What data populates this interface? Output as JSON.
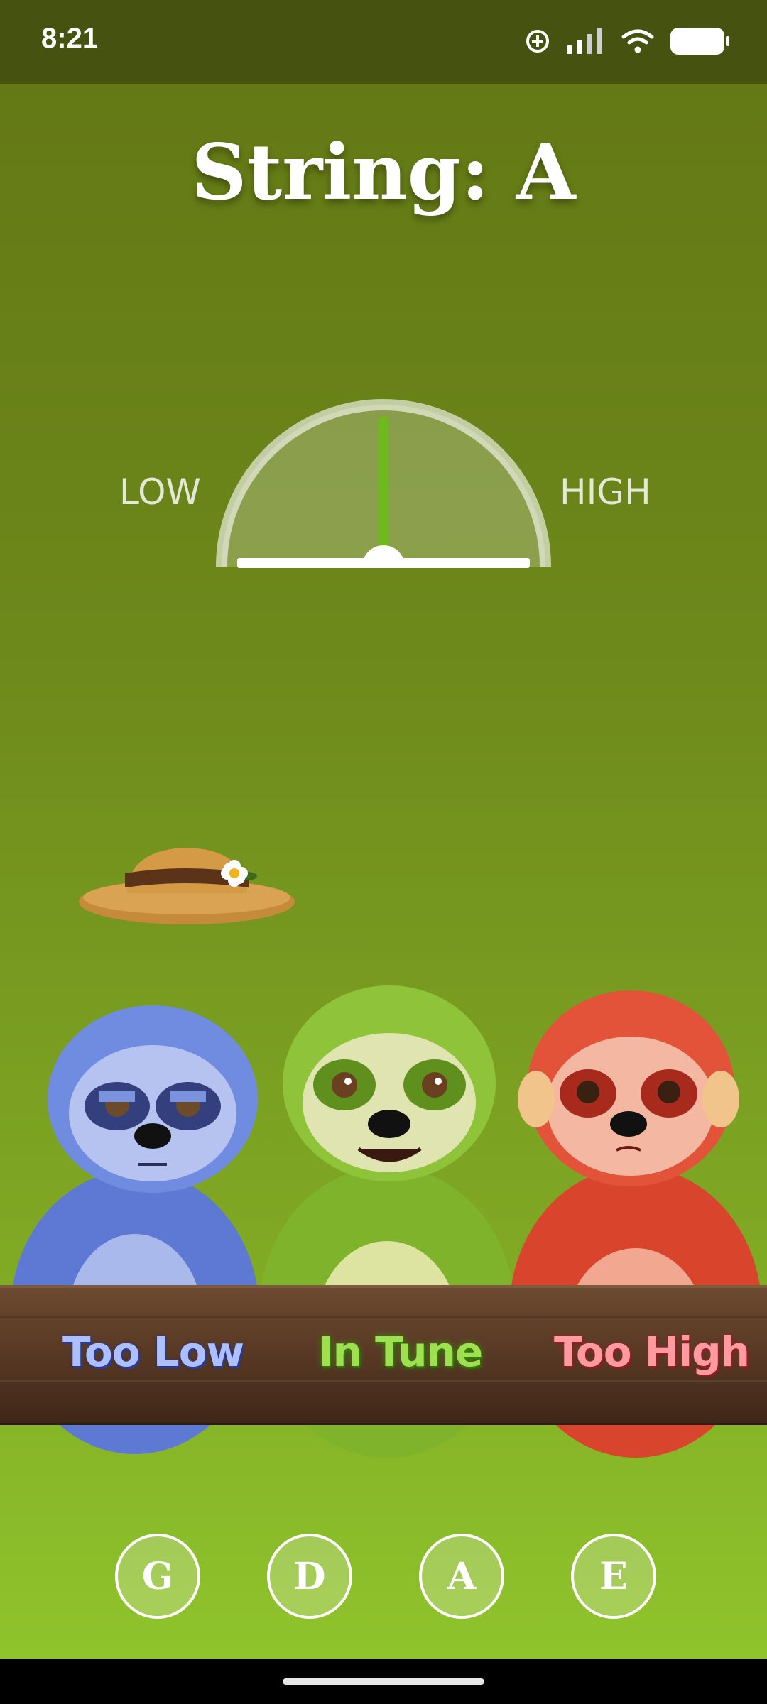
{
  "status_bar": {
    "time": "8:21",
    "icons": [
      "data-saver-icon",
      "signal-icon",
      "wifi-icon",
      "battery-icon"
    ]
  },
  "header": {
    "title": "String: A"
  },
  "tuner_gauge": {
    "low_label": "LOW",
    "high_label": "HIGH",
    "needle_deviation": 0,
    "needle_color": "#6dbb1a"
  },
  "sloth_panel": {
    "images": [
      "hat-image",
      "blue-sloth-image",
      "green-sloth-image",
      "red-sloth-image"
    ],
    "labels": [
      "Too Low",
      "In Tune",
      "Too High"
    ],
    "label_colors": [
      "#aebfff",
      "#9fe050",
      "#ff9aa0"
    ]
  },
  "string_buttons": [
    {
      "label": "G"
    },
    {
      "label": "D"
    },
    {
      "label": "A"
    },
    {
      "label": "E"
    }
  ],
  "colors": {
    "background_top": "#647915",
    "background_bottom": "#8fc42c",
    "status_bar": "#465210"
  }
}
